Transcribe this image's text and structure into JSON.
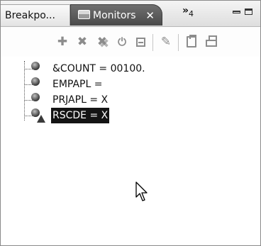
{
  "tabs": [
    {
      "label": "Breakpo...",
      "active": false
    },
    {
      "label": "Monitors",
      "active": true,
      "close_glyph": "✕"
    }
  ],
  "overflow": {
    "glyph": "»",
    "count": "4"
  },
  "toolbar": {
    "buttons": [
      {
        "name": "add-watch-expression",
        "icon": "plus-icon",
        "glyph": "✚"
      },
      {
        "name": "remove",
        "icon": "remove-x-icon",
        "glyph": "✖"
      },
      {
        "name": "remove-all",
        "icon": "remove-all-icon",
        "glyph": "✖"
      },
      {
        "name": "disconnect",
        "icon": "disconnect-icon",
        "glyph": "⏻"
      },
      {
        "name": "collapse-all",
        "icon": "collapse-all-icon"
      },
      {
        "name": "refresh-monitor",
        "icon": "refresh-monitor-icon",
        "glyph": "✎"
      },
      {
        "name": "copy",
        "icon": "clipboard-icon"
      },
      {
        "name": "print",
        "icon": "printer-icon"
      }
    ]
  },
  "monitors": [
    {
      "label": "&COUNT = 00100.",
      "status": "ok",
      "selected": false
    },
    {
      "label": "EMPAPL =",
      "status": "ok",
      "selected": false
    },
    {
      "label": "PRJAPL = X",
      "status": "ok",
      "selected": false
    },
    {
      "label": "RSCDE = X",
      "status": "warning",
      "selected": true
    }
  ],
  "colors": {
    "selection_bg": "#141414",
    "selection_fg": "#ffffff",
    "active_tab_bg": "#5a5a5a",
    "icon_gray": "#8c8c8c"
  }
}
